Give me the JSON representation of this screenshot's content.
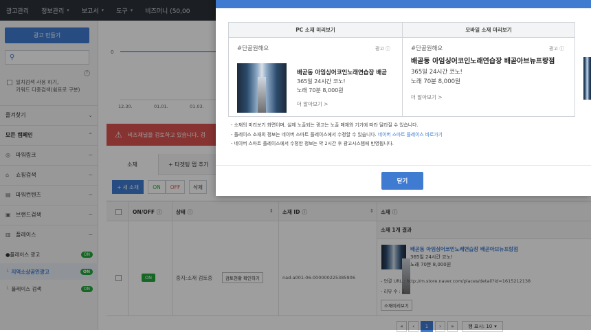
{
  "topbar": {
    "menus": [
      {
        "label": "광고관리",
        "chevron": false
      },
      {
        "label": "정보관리",
        "chevron": true
      },
      {
        "label": "보고서",
        "chevron": true
      },
      {
        "label": "도구",
        "chevron": true
      },
      {
        "label": "비즈머니 (50,00",
        "chevron": false
      }
    ]
  },
  "sidebar": {
    "create_button": "광고 만들기",
    "search_placeholder": "",
    "check_label_1": "일치검색 사용 하기,",
    "check_label_2": "키워드 다중검색(쉼표로 구분)",
    "favorites": "즐겨찾기",
    "all_campaigns": "모든 캠페인",
    "campaigns": [
      {
        "label": "파워링크",
        "icon": "globe-icon"
      },
      {
        "label": "쇼핑검색",
        "icon": "bag-icon"
      },
      {
        "label": "파워컨텐츠",
        "icon": "doc-icon"
      },
      {
        "label": "브랜드검색",
        "icon": "brand-icon"
      },
      {
        "label": "플레이스",
        "icon": "place-icon"
      }
    ],
    "place_ad": "플레이스 광고",
    "sub_group_1": "지역소상공인광고",
    "sub_group_2": "플레이스 검색",
    "on_label": "ON"
  },
  "chart": {
    "y_zero": "0",
    "x_ticks": [
      "12.30.",
      "01.01.",
      "01.03."
    ]
  },
  "alert": {
    "text": "비즈채널을 검토하고 있습니다. 검"
  },
  "tabs": {
    "items": [
      "소재",
      "+ 타겟팅 탭 추가"
    ]
  },
  "toolbar": {
    "new_material": "+ 새 소재",
    "on": "ON",
    "off": "OFF",
    "delete": "삭제"
  },
  "table": {
    "headers": {
      "onoff": "ON/OFF",
      "status": "상태",
      "material_id": "소재 ID",
      "material": "소재"
    },
    "subhead": "소재 1개 결과",
    "row": {
      "toggle": "ON",
      "status_text": "중지:소재 검토중",
      "review_button": "검토현황 확인하기",
      "material_id": "nad-a001-06-000000225385906",
      "ad_title": "배곧동 아임싱어코인노래연습장 배곧아브뉴프랑점",
      "ad_line_1": "365일 24시간 코노!",
      "ad_line_2": "노래 70분 8,000원",
      "link_url": "- 연결 URL : http://m.store.naver.com/places/detail?id=1615212138",
      "review_count": "- 리뷰 수 : 2",
      "preview_button": "소재미리보기"
    },
    "pager": {
      "first": "«",
      "prev": "‹",
      "current": "1",
      "next": "›",
      "last": "»",
      "per_page": "행 표시: 10"
    }
  },
  "modal": {
    "pc_header": "PC 소재 미리보기",
    "mobile_header": "모바일 소재 미리보기",
    "hashtag": "#단골원해요",
    "ad_badge": "광고",
    "pc_title": "배곧동 아임싱어코인노래연습장 배곧",
    "mobile_title": "배곧동 아임싱어코인노래연습장 배곧아브뉴프랑점",
    "line_1": "365일 24시간 코노!",
    "line_2": "노래 70분 8,000원",
    "more": "더 알아보기 >",
    "notes": [
      "- 소재의 미리보기 화면이며, 실제 노출되는 광고는 노출 매체와 기기에 따라 달라질 수 있습니다.",
      "- 플레이스 소재의 정보는 네이버 스마트 플레이스에서 수정할 수 있습니다.",
      "- 네이버 스마트 플레이스에서 수정한 정보는 약 2시간 후 광고시스템에 반영됩니다."
    ],
    "notes_link": "네이버 스마트 플레이스 바로가기",
    "close_button": "닫기"
  },
  "colors": {
    "accent": "#3f7bd0",
    "alert": "#d9534f",
    "toggle_on": "#22a63a"
  }
}
